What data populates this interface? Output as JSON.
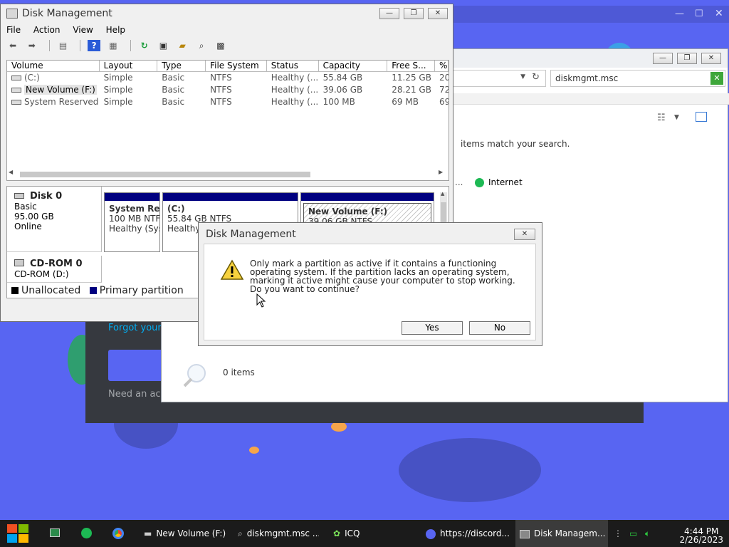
{
  "dm": {
    "title": "Disk Management",
    "menu": [
      "File",
      "Action",
      "View",
      "Help"
    ],
    "columns": [
      "Volume",
      "Layout",
      "Type",
      "File System",
      "Status",
      "Capacity",
      "Free S...",
      "% I"
    ],
    "rows": [
      [
        "(C:)",
        "Simple",
        "Basic",
        "NTFS",
        "Healthy (...",
        "55.84 GB",
        "11.25 GB",
        "20"
      ],
      [
        "New Volume (F:)",
        "Simple",
        "Basic",
        "NTFS",
        "Healthy (...",
        "39.06 GB",
        "28.21 GB",
        "72"
      ],
      [
        "System Reserved",
        "Simple",
        "Basic",
        "NTFS",
        "Healthy (...",
        "100 MB",
        "69 MB",
        "69"
      ]
    ],
    "disk0": {
      "name": "Disk 0",
      "type": "Basic",
      "size": "95.00 GB",
      "state": "Online"
    },
    "partitions": [
      {
        "name": "System Re",
        "size": "100 MB NTF",
        "status": "Healthy (Sys"
      },
      {
        "name": "(C:)",
        "size": "55.84 GB NTFS",
        "status": "Healthy"
      },
      {
        "name": "New Volume  (F:)",
        "size": "39.06 GB NTFS",
        "status": ""
      }
    ],
    "cdrom": {
      "name": "CD-ROM 0",
      "drive": "CD-ROM (D:)"
    },
    "legend": {
      "unallocated": "Unallocated",
      "primary": "Primary partition"
    },
    "colors": {
      "primary": "#000080",
      "unallocated": "#000000"
    }
  },
  "dialog": {
    "title": "Disk Management",
    "message": "Only mark a partition as active if it contains a functioning operating system. If the partition lacks an operating system, marking it active might cause your computer to stop working. Do you want to continue?",
    "yes": "Yes",
    "no": "No"
  },
  "explorer": {
    "search": "diskmgmt.msc",
    "no_match": "items match your search.",
    "location": "Internet",
    "ellipsis": "...",
    "count": "0 items"
  },
  "discord": {
    "forgot": "Forgot your",
    "need_account": "Need an acc"
  },
  "taskbar": {
    "items": [
      "New Volume (F:)",
      "diskmgmt.msc ...",
      "ICQ",
      "https://discord...",
      "Disk Managem..."
    ],
    "time": "4:44 PM",
    "date": "2/26/2023"
  }
}
